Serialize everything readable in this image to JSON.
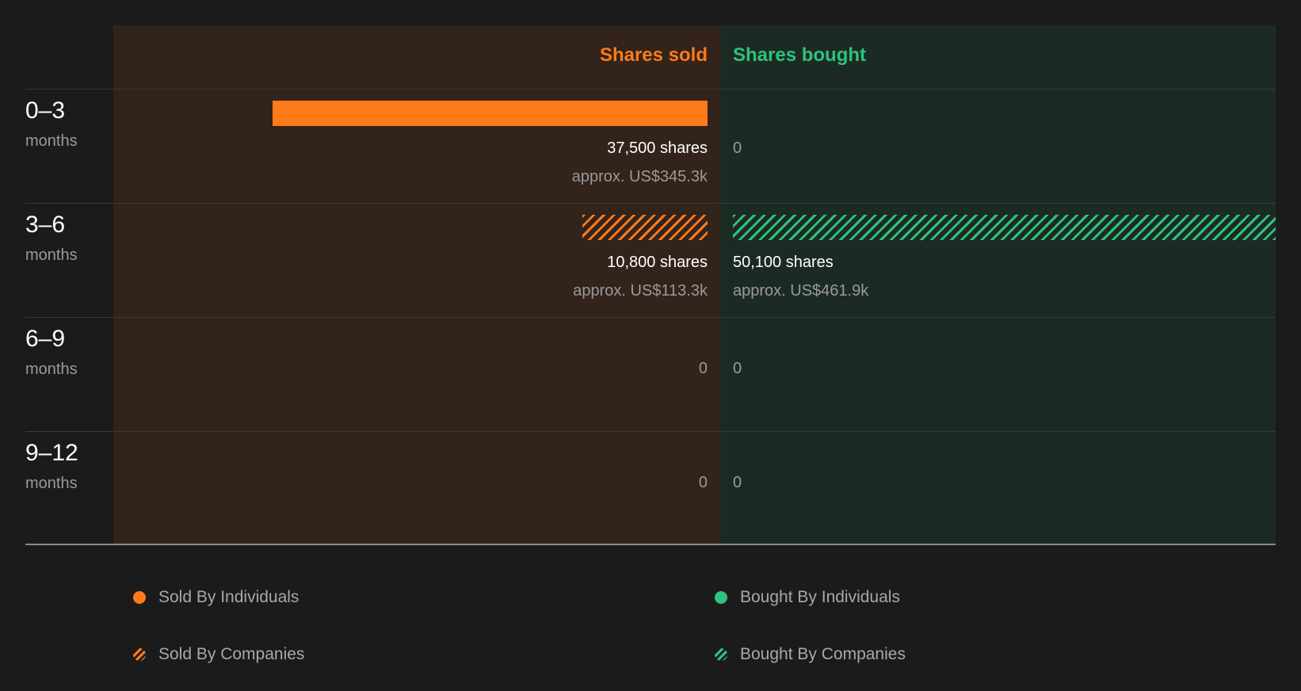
{
  "chart_data": {
    "type": "bar",
    "orientation": "horizontal-diverging",
    "headers": {
      "sold": "Shares sold",
      "bought": "Shares bought"
    },
    "periods": [
      {
        "range": "0–3",
        "unit": "months",
        "sold": {
          "shares": 37500,
          "shares_text": "37,500 shares",
          "approx": "approx. US$345.3k",
          "by": "individuals"
        },
        "bought": {
          "shares": 0,
          "shares_text": "0",
          "approx": "",
          "by": ""
        }
      },
      {
        "range": "3–6",
        "unit": "months",
        "sold": {
          "shares": 10800,
          "shares_text": "10,800 shares",
          "approx": "approx. US$113.3k",
          "by": "companies"
        },
        "bought": {
          "shares": 50100,
          "shares_text": "50,100 shares",
          "approx": "approx. US$461.9k",
          "by": "companies"
        }
      },
      {
        "range": "6–9",
        "unit": "months",
        "sold": {
          "shares": 0,
          "shares_text": "0",
          "approx": "",
          "by": ""
        },
        "bought": {
          "shares": 0,
          "shares_text": "0",
          "approx": "",
          "by": ""
        }
      },
      {
        "range": "9–12",
        "unit": "months",
        "sold": {
          "shares": 0,
          "shares_text": "0",
          "approx": "",
          "by": ""
        },
        "bought": {
          "shares": 0,
          "shares_text": "0",
          "approx": "",
          "by": ""
        }
      }
    ],
    "legend": [
      {
        "label": "Sold By Individuals",
        "style": "solid",
        "color": "#ff7a18"
      },
      {
        "label": "Bought By Individuals",
        "style": "solid",
        "color": "#2ec27e"
      },
      {
        "label": "Sold By Companies",
        "style": "hatched",
        "color": "#ff7a18"
      },
      {
        "label": "Bought By Companies",
        "style": "hatched",
        "color": "#2ec27e"
      }
    ],
    "legend_placement": "bottom",
    "colors": {
      "sold": "#ff7a18",
      "bought": "#2ec27e"
    }
  }
}
